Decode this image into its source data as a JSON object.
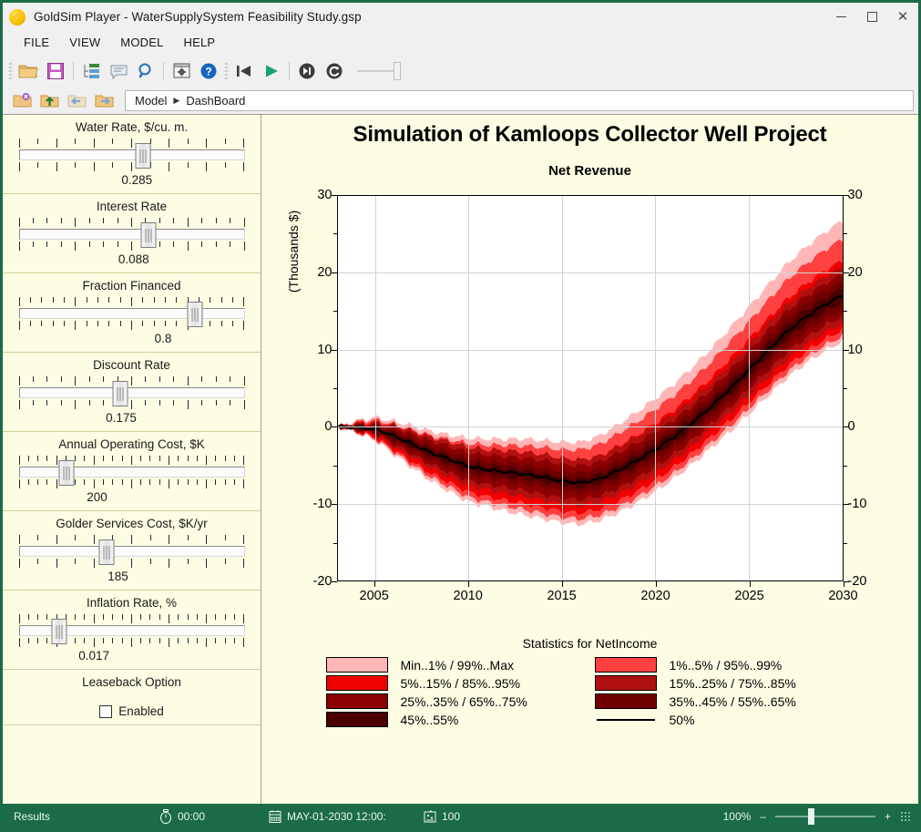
{
  "window": {
    "title": "GoldSim Player - WaterSupplySystem Feasibility Study.gsp",
    "app_icon": "goldsim-lightning-icon",
    "minimize_label": "–",
    "maximize_label": "□",
    "close_label": "✕"
  },
  "menubar": {
    "items": [
      {
        "label": "FILE"
      },
      {
        "label": "VIEW"
      },
      {
        "label": "MODEL"
      },
      {
        "label": "HELP"
      }
    ]
  },
  "toolbar": {
    "row1": [
      {
        "name": "open-folder-icon",
        "title": "Open"
      },
      {
        "name": "save-icon",
        "title": "Save"
      },
      {
        "name": "model-tree-icon",
        "title": "Model Tree"
      },
      {
        "name": "note-icon",
        "title": "Notes"
      },
      {
        "name": "search-icon",
        "title": "Find"
      },
      {
        "name": "settings-window-icon",
        "title": "Options"
      },
      {
        "name": "help-icon",
        "title": "Help"
      },
      {
        "name": "skip-back-icon",
        "title": "Reset"
      },
      {
        "name": "play-icon",
        "title": "Run"
      },
      {
        "name": "step-icon",
        "title": "Step"
      },
      {
        "name": "reset-loop-icon",
        "title": "Restart"
      }
    ],
    "row2": [
      {
        "name": "folder-back-icon",
        "title": "Go Back"
      },
      {
        "name": "folder-up-icon",
        "title": "Go Up"
      },
      {
        "name": "folder-prev-icon",
        "title": "Previous"
      },
      {
        "name": "folder-next-icon",
        "title": "Next"
      }
    ]
  },
  "breadcrumb": {
    "root": "Model",
    "separator": "▶",
    "current": "DashBoard"
  },
  "sidebar": {
    "sliders": [
      {
        "title": "Water Rate, $/cu. m.",
        "value": "0.285",
        "pct": 55.0,
        "value_pct": 55.0,
        "majors": 7,
        "minors_between": 1
      },
      {
        "title": "Interest Rate",
        "value": "0.088",
        "pct": 57.5,
        "value_pct": 52.0,
        "majors": 5,
        "minors_between": 3
      },
      {
        "title": "Fraction Financed",
        "value": "0.8",
        "pct": 78.0,
        "value_pct": 80.0,
        "majors": 5,
        "minors_between": 4
      },
      {
        "title": "Discount Rate",
        "value": "0.175",
        "pct": 45.0,
        "value_pct": 40.0,
        "majors": 5,
        "minors_between": 3
      },
      {
        "title": "Annual Operating Cost, $K",
        "value": "200",
        "pct": 21.0,
        "value_pct": 17.0,
        "majors": 7,
        "minors_between": 3
      },
      {
        "title": "Golder Services Cost, $K/yr",
        "value": "185",
        "pct": 39.0,
        "value_pct": 37.0,
        "majors": 7,
        "minors_between": 1
      },
      {
        "title": "Inflation Rate, %",
        "value": "0.017",
        "pct": 18.0,
        "value_pct": 14.0,
        "majors": 7,
        "minors_between": 3
      }
    ],
    "option": {
      "title": "Leaseback Option",
      "checkbox_label": "Enabled",
      "checked": false
    }
  },
  "dashboard": {
    "title": "Simulation of Kamloops Collector Well Project",
    "subtitle": "Net Revenue"
  },
  "chart_data": {
    "type": "area",
    "title": "Net Revenue",
    "subtitle": "Simulation of Kamloops Collector Well Project",
    "xlabel": "",
    "ylabel": "(Thousands $)",
    "xlim": [
      2003,
      2030
    ],
    "ylim": [
      -20,
      30
    ],
    "x_ticks": [
      "2005",
      "2010",
      "2015",
      "2020",
      "2025",
      "2030"
    ],
    "x_tick_values": [
      2005,
      2010,
      2015,
      2020,
      2025,
      2030
    ],
    "y_ticks": [
      "30",
      "20",
      "10",
      "0",
      "-10",
      "-20"
    ],
    "y_tick_values": [
      30,
      20,
      10,
      0,
      -10,
      -20
    ],
    "y_minor_values": [
      25,
      15,
      5,
      -5,
      -15
    ],
    "grid": true,
    "dual_y_axis": true,
    "x": [
      2003,
      2004,
      2005,
      2006,
      2007,
      2008,
      2009,
      2010,
      2011,
      2012,
      2013,
      2014,
      2015,
      2016,
      2017,
      2018,
      2019,
      2020,
      2021,
      2022,
      2023,
      2024,
      2025,
      2026,
      2027,
      2028,
      2029,
      2030
    ],
    "series": [
      {
        "name": "50%",
        "band": "median",
        "color": "#000000",
        "values": [
          0.0,
          -0.1,
          -0.3,
          -1.2,
          -2.3,
          -3.4,
          -4.3,
          -5.2,
          -5.6,
          -5.9,
          -6.2,
          -6.6,
          -7.1,
          -7.3,
          -6.8,
          -5.7,
          -4.4,
          -2.9,
          -1.3,
          0.6,
          2.7,
          5.0,
          7.4,
          9.9,
          12.3,
          14.2,
          15.8,
          17.1
        ]
      },
      {
        "name": "45%..55%",
        "band": "p45_p55",
        "color": "#4A0000",
        "lower": [
          0.0,
          -0.2,
          -0.5,
          -1.5,
          -2.7,
          -3.8,
          -4.8,
          -5.7,
          -6.1,
          -6.5,
          -6.8,
          -7.2,
          -7.7,
          -7.9,
          -7.4,
          -6.4,
          -5.1,
          -3.6,
          -2.0,
          -0.1,
          2.0,
          4.2,
          6.6,
          9.0,
          11.4,
          13.3,
          14.9,
          16.2
        ],
        "upper": [
          0.0,
          0.0,
          -0.1,
          -0.9,
          -1.9,
          -3.0,
          -3.8,
          -4.7,
          -5.1,
          -5.3,
          -5.6,
          -6.0,
          -6.5,
          -6.7,
          -6.2,
          -5.0,
          -3.7,
          -2.2,
          -0.6,
          1.3,
          3.4,
          5.8,
          8.2,
          10.8,
          13.2,
          15.1,
          16.7,
          18.0
        ]
      },
      {
        "name": "35%..45% / 55%..65%",
        "band": "p35_p65",
        "color": "#700000",
        "lower": [
          0.0,
          -0.3,
          -0.7,
          -1.9,
          -3.1,
          -4.3,
          -5.3,
          -6.3,
          -6.7,
          -7.1,
          -7.5,
          -7.9,
          -8.4,
          -8.6,
          -8.1,
          -7.1,
          -5.8,
          -4.3,
          -2.7,
          -0.8,
          1.3,
          3.4,
          5.8,
          8.1,
          10.5,
          12.4,
          14.0,
          15.3
        ]
      },
      {
        "name": "25%..35% / 65%..75%",
        "band": "p25_p75",
        "color": "#8B0000",
        "lower": [
          0.0,
          -0.4,
          -0.9,
          -2.3,
          -3.6,
          -4.9,
          -6.0,
          -7.0,
          -7.5,
          -7.9,
          -8.3,
          -8.8,
          -9.3,
          -9.5,
          -9.0,
          -8.0,
          -6.7,
          -5.2,
          -3.5,
          -1.6,
          0.5,
          2.6,
          5.0,
          7.3,
          9.6,
          11.5,
          13.1,
          14.4
        ]
      },
      {
        "name": "15%..25% / 75%..85%",
        "band": "p15_p85",
        "color": "#B01010",
        "lower": [
          0.0,
          -0.5,
          -1.1,
          -2.6,
          -4.0,
          -5.4,
          -6.6,
          -7.7,
          -8.2,
          -8.7,
          -9.1,
          -9.6,
          -10.1,
          -10.3,
          -9.8,
          -8.8,
          -7.5,
          -6.0,
          -4.3,
          -2.4,
          -0.3,
          1.8,
          4.1,
          6.4,
          8.7,
          10.6,
          12.2,
          13.5
        ]
      },
      {
        "name": "5%..15% / 85%..95%",
        "band": "p05_p95",
        "color": "#F00000",
        "lower": [
          0.0,
          -0.6,
          -1.4,
          -3.0,
          -4.6,
          -6.1,
          -7.3,
          -8.5,
          -9.1,
          -9.6,
          -10.0,
          -10.5,
          -11.0,
          -11.2,
          -10.7,
          -9.7,
          -8.4,
          -6.9,
          -5.2,
          -3.3,
          -1.2,
          0.9,
          3.2,
          5.5,
          7.8,
          9.7,
          11.3,
          12.6
        ],
        "upper": [
          0.0,
          0.4,
          0.6,
          -0.2,
          -1.0,
          -1.9,
          -2.5,
          -3.1,
          -3.4,
          -3.5,
          -3.7,
          -4.0,
          -4.3,
          -4.4,
          -3.8,
          -2.5,
          -1.1,
          0.5,
          2.2,
          4.2,
          6.4,
          8.9,
          11.4,
          14.0,
          16.5,
          18.5,
          20.2,
          21.6
        ]
      },
      {
        "name": "1%..5% / 95%..99%",
        "band": "p01_p99",
        "color": "#FF4040",
        "lower": [
          0.0,
          -0.7,
          -1.6,
          -3.3,
          -5.0,
          -6.6,
          -7.9,
          -9.2,
          -9.8,
          -10.3,
          -10.8,
          -11.3,
          -11.8,
          -12.0,
          -11.5,
          -10.5,
          -9.2,
          -7.7,
          -6.0,
          -4.1,
          -2.0,
          0.1,
          2.4,
          4.7,
          7.0,
          8.9,
          10.5,
          11.8
        ],
        "upper": [
          0.0,
          0.6,
          0.9,
          0.3,
          -0.4,
          -1.2,
          -1.7,
          -2.2,
          -2.4,
          -2.4,
          -2.5,
          -2.7,
          -3.0,
          -3.0,
          -2.3,
          -0.9,
          0.6,
          2.3,
          4.1,
          6.2,
          8.5,
          11.1,
          13.7,
          16.4,
          19.0,
          21.1,
          22.9,
          24.4
        ]
      },
      {
        "name": "Min..1% / 99%..Max",
        "band": "min_max",
        "color": "#FFB6B6",
        "lower": [
          0.0,
          -0.8,
          -1.8,
          -3.6,
          -5.4,
          -7.1,
          -8.5,
          -9.8,
          -10.4,
          -11.0,
          -11.5,
          -12.0,
          -12.5,
          -12.7,
          -12.2,
          -11.2,
          -9.9,
          -8.4,
          -6.7,
          -4.8,
          -2.7,
          -0.6,
          1.7,
          4.0,
          6.3,
          8.2,
          9.8,
          11.1
        ],
        "upper": [
          0.0,
          0.8,
          1.2,
          0.7,
          0.1,
          -0.6,
          -1.1,
          -1.5,
          -1.6,
          -1.6,
          -1.6,
          -1.8,
          -2.0,
          -2.0,
          -1.2,
          0.3,
          1.9,
          3.7,
          5.6,
          7.8,
          10.2,
          12.9,
          15.6,
          18.4,
          21.1,
          23.3,
          25.2,
          26.8
        ]
      }
    ]
  },
  "legend": {
    "title": "Statistics for NetIncome",
    "entries": [
      {
        "label": "Min..1% / 99%..Max",
        "color": "#FFB6B6",
        "type": "swatch"
      },
      {
        "label": "1%..5% / 95%..99%",
        "color": "#FF4040",
        "type": "swatch"
      },
      {
        "label": "5%..15% / 85%..95%",
        "color": "#F00000",
        "type": "swatch"
      },
      {
        "label": "15%..25% / 75%..85%",
        "color": "#B01010",
        "type": "swatch"
      },
      {
        "label": "25%..35% / 65%..75%",
        "color": "#8B0000",
        "type": "swatch"
      },
      {
        "label": "35%..45% / 55%..65%",
        "color": "#700000",
        "type": "swatch"
      },
      {
        "label": "45%..55%",
        "color": "#4A0000",
        "type": "swatch"
      },
      {
        "label": "50%",
        "color": "#000000",
        "type": "line"
      }
    ]
  },
  "statusbar": {
    "mode": "Results",
    "elapsed_icon": "stopwatch-icon",
    "elapsed": "00:00",
    "date_icon": "calendar-icon",
    "date": "MAY-01-2030 12:00:",
    "runs_icon": "realizations-icon",
    "runs": "100",
    "zoom_level": "100%",
    "zoom_out_label": "–",
    "zoom_in_label": "+",
    "resize_grip": "resize-grip-icon"
  }
}
